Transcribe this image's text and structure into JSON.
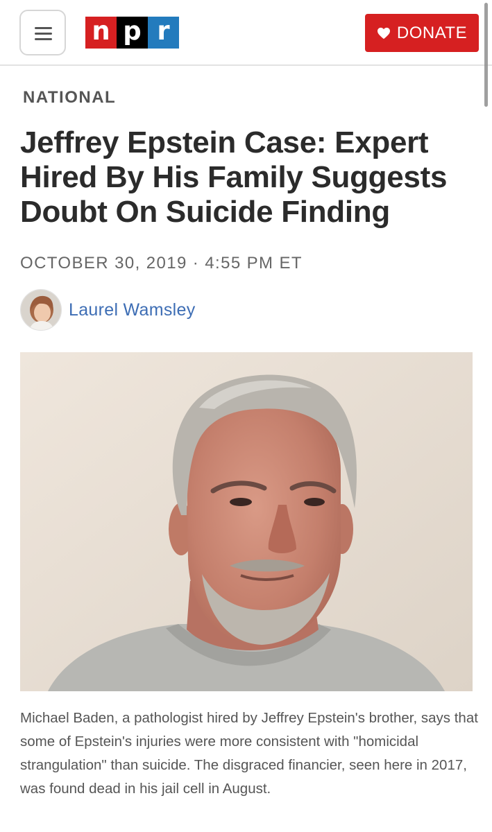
{
  "header": {
    "menu_icon": "hamburger-menu-icon",
    "logo_letters": [
      "n",
      "p",
      "r"
    ],
    "donate_label": "DONATE",
    "donate_icon": "heart-icon",
    "colors": {
      "npr_red": "#d62021",
      "npr_black": "#000000",
      "npr_blue": "#237bbd"
    }
  },
  "article": {
    "section": "NATIONAL",
    "headline": "Jeffrey Epstein Case: Expert Hired By His Family Suggests Doubt On Suicide Finding",
    "dateline": "OCTOBER 30, 2019 · 4:55 PM ET",
    "author": "Laurel Wamsley",
    "caption": "Michael Baden, a pathologist hired by Jeffrey Epstein's brother, says that some of Epstein's injuries were more consistent with \"homicidal strangulation\" than suicide. The disgraced financier, seen here in 2017, was found dead in his jail cell in August."
  },
  "colors": {
    "author_link": "#3d6db4",
    "donate_bg": "#d62021"
  }
}
